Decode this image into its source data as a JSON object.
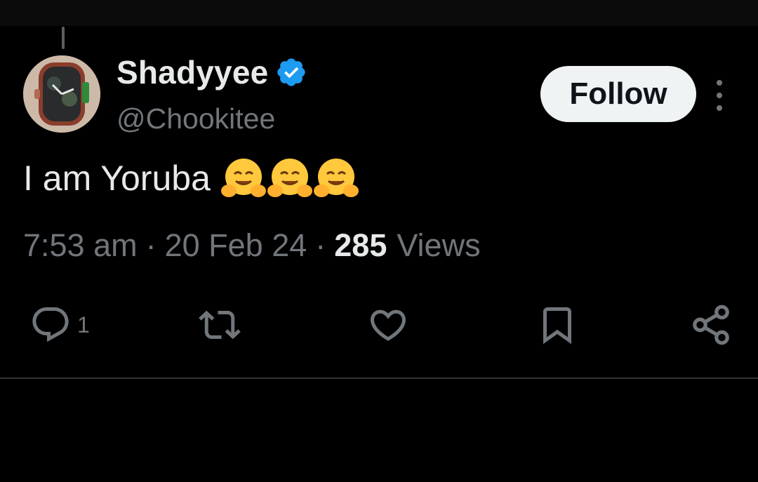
{
  "tweet": {
    "author": {
      "display_name": "Shadyyee",
      "handle": "@Chookitee",
      "verified": true,
      "avatar": "watch-photo"
    },
    "follow_label": "Follow",
    "text": "I am Yoruba",
    "emojis": [
      "hugging-face",
      "hugging-face",
      "hugging-face"
    ],
    "time": "7:53 am",
    "date": "20 Feb 24",
    "views_count": "285",
    "views_label": "Views",
    "separator": "·",
    "actions": {
      "reply_count": "1"
    }
  },
  "colors": {
    "background": "#000000",
    "text_primary": "#e7e9ea",
    "text_secondary": "#71767b",
    "verified_blue": "#1d9bf0",
    "follow_bg": "#eff3f4"
  },
  "icons": [
    "verified-badge-icon",
    "more-icon",
    "reply-icon",
    "retweet-icon",
    "like-icon",
    "bookmark-icon",
    "share-icon"
  ]
}
